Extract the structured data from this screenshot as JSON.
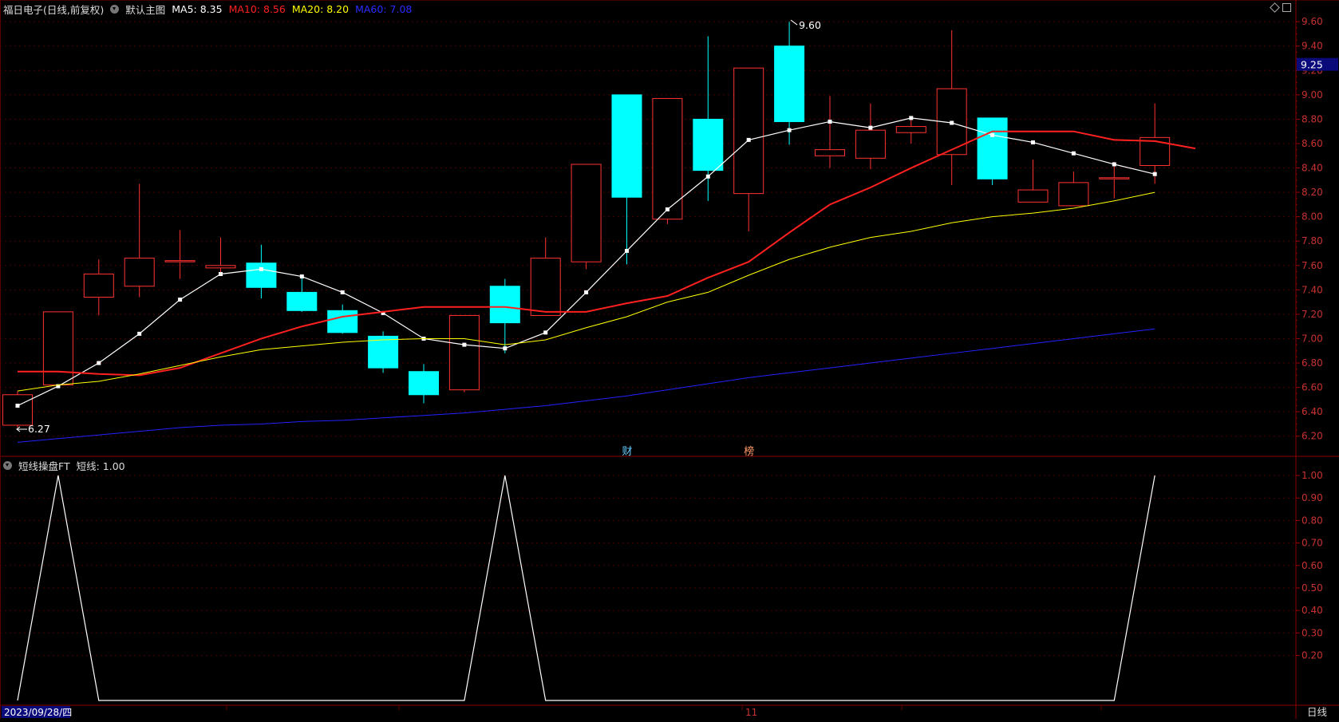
{
  "header": {
    "title": "福日电子(日线,前复权)",
    "template": "默认主图",
    "ma": [
      {
        "label": "MA5: 8.35",
        "color": "#ffffff"
      },
      {
        "label": "MA10: 8.56",
        "color": "#ff2020"
      },
      {
        "label": "MA20: 8.20",
        "color": "#ffff00"
      },
      {
        "label": "MA60: 7.08",
        "color": "#2222ff"
      }
    ]
  },
  "subheader": {
    "name": "短线操盘FT",
    "value": "短线: 1.00"
  },
  "footer": {
    "date": "2023/09/28/四",
    "month_marker": "11",
    "period": "日线"
  },
  "markers": {
    "finance": "财",
    "list": "榜"
  },
  "chart_data": [
    {
      "type": "candlestick",
      "ylim": [
        6.1,
        9.66
      ],
      "yticks": [
        "9.60",
        "9.40",
        "9.20",
        "9.00",
        "8.80",
        "8.60",
        "8.40",
        "8.20",
        "8.00",
        "7.80",
        "7.60",
        "7.40",
        "7.20",
        "7.00",
        "6.80",
        "6.60",
        "6.40",
        "6.20"
      ],
      "current_price": "9.25",
      "annotations": [
        {
          "text": "9.60",
          "index": 19,
          "value": 9.6
        },
        {
          "text": "6.27",
          "index": 0,
          "value": 6.27
        }
      ],
      "up_color": "#ff3232",
      "down_color": "#00ffff",
      "candles": [
        {
          "o": 6.29,
          "h": 6.57,
          "l": 6.27,
          "c": 6.54
        },
        {
          "o": 6.62,
          "h": 7.22,
          "l": 6.62,
          "c": 7.22
        },
        {
          "o": 7.34,
          "h": 7.65,
          "l": 7.19,
          "c": 7.53
        },
        {
          "o": 7.43,
          "h": 8.27,
          "l": 7.34,
          "c": 7.66
        },
        {
          "o": 7.64,
          "h": 7.89,
          "l": 7.49,
          "c": 7.64
        },
        {
          "o": 7.58,
          "h": 7.83,
          "l": 7.53,
          "c": 7.6
        },
        {
          "o": 7.62,
          "h": 7.77,
          "l": 7.33,
          "c": 7.42
        },
        {
          "o": 7.38,
          "h": 7.5,
          "l": 7.22,
          "c": 7.23
        },
        {
          "o": 7.23,
          "h": 7.28,
          "l": 7.04,
          "c": 7.05
        },
        {
          "o": 7.02,
          "h": 7.06,
          "l": 6.72,
          "c": 6.76
        },
        {
          "o": 6.73,
          "h": 6.79,
          "l": 6.47,
          "c": 6.54
        },
        {
          "o": 6.58,
          "h": 7.19,
          "l": 6.56,
          "c": 7.19
        },
        {
          "o": 7.43,
          "h": 7.49,
          "l": 6.88,
          "c": 7.13
        },
        {
          "o": 7.19,
          "h": 7.83,
          "l": 7.19,
          "c": 7.66
        },
        {
          "o": 7.63,
          "h": 8.43,
          "l": 7.57,
          "c": 8.43
        },
        {
          "o": 9.0,
          "h": 9.0,
          "l": 7.61,
          "c": 8.16
        },
        {
          "o": 7.98,
          "h": 8.97,
          "l": 7.94,
          "c": 8.97
        },
        {
          "o": 8.8,
          "h": 9.48,
          "l": 8.13,
          "c": 8.38
        },
        {
          "o": 8.19,
          "h": 9.22,
          "l": 7.88,
          "c": 9.22
        },
        {
          "o": 9.4,
          "h": 9.6,
          "l": 8.59,
          "c": 8.78
        },
        {
          "o": 8.5,
          "h": 8.99,
          "l": 8.4,
          "c": 8.55
        },
        {
          "o": 8.48,
          "h": 8.93,
          "l": 8.39,
          "c": 8.71
        },
        {
          "o": 8.69,
          "h": 8.81,
          "l": 8.6,
          "c": 8.74
        },
        {
          "o": 8.51,
          "h": 9.53,
          "l": 8.26,
          "c": 9.05
        },
        {
          "o": 8.81,
          "h": 8.81,
          "l": 8.26,
          "c": 8.31
        },
        {
          "o": 8.12,
          "h": 8.47,
          "l": 8.12,
          "c": 8.22
        },
        {
          "o": 8.09,
          "h": 8.37,
          "l": 8.09,
          "c": 8.28
        },
        {
          "o": 8.32,
          "h": 8.45,
          "l": 8.15,
          "c": 8.32
        },
        {
          "o": 8.42,
          "h": 8.93,
          "l": 8.27,
          "c": 8.65
        }
      ],
      "series": [
        {
          "name": "MA5",
          "color": "#ffffff",
          "width": 1.2,
          "markers": true,
          "values": [
            6.45,
            6.61,
            6.8,
            7.04,
            7.32,
            7.53,
            7.57,
            7.51,
            7.38,
            7.21,
            7.0,
            6.95,
            6.92,
            7.05,
            7.38,
            7.72,
            8.06,
            8.33,
            8.63,
            8.71,
            8.78,
            8.73,
            8.81,
            8.77,
            8.67,
            8.61,
            8.52,
            8.43,
            8.35
          ]
        },
        {
          "name": "MA10",
          "color": "#ff2020",
          "width": 2,
          "values": [
            6.73,
            6.73,
            6.71,
            6.7,
            6.76,
            6.88,
            7.0,
            7.1,
            7.18,
            7.22,
            7.26,
            7.26,
            7.26,
            7.22,
            7.22,
            7.29,
            7.35,
            7.5,
            7.63,
            7.87,
            8.1,
            8.24,
            8.4,
            8.55,
            8.7,
            8.7,
            8.7,
            8.63,
            8.62,
            8.56
          ]
        },
        {
          "name": "MA20",
          "color": "#ffff00",
          "width": 1,
          "values": [
            6.57,
            6.62,
            6.65,
            6.71,
            6.78,
            6.85,
            6.91,
            6.94,
            6.97,
            6.99,
            7.0,
            7.0,
            6.95,
            6.99,
            7.09,
            7.18,
            7.3,
            7.38,
            7.52,
            7.65,
            7.75,
            7.83,
            7.88,
            7.95,
            8.0,
            8.03,
            8.07,
            8.13,
            8.2
          ]
        },
        {
          "name": "MA60",
          "color": "#2222ff",
          "width": 1,
          "values": [
            6.15,
            6.18,
            6.21,
            6.24,
            6.27,
            6.29,
            6.3,
            6.32,
            6.33,
            6.35,
            6.37,
            6.39,
            6.42,
            6.45,
            6.49,
            6.53,
            6.58,
            6.63,
            6.68,
            6.72,
            6.76,
            6.8,
            6.84,
            6.88,
            6.92,
            6.96,
            7.0,
            7.04,
            7.08
          ]
        }
      ]
    },
    {
      "type": "line",
      "name": "短线",
      "ylim": [
        0,
        1.05
      ],
      "yticks": [
        "1.00",
        "0.90",
        "0.80",
        "0.70",
        "0.60",
        "0.50",
        "0.40",
        "0.30",
        "0.20"
      ],
      "color": "#ffffff",
      "values": [
        0,
        1,
        0,
        0,
        0,
        0,
        0,
        0,
        0,
        0,
        0,
        0,
        1,
        0,
        0,
        0,
        0,
        0,
        0,
        0,
        0,
        0,
        0,
        0,
        0,
        0,
        0,
        0,
        1
      ]
    }
  ]
}
